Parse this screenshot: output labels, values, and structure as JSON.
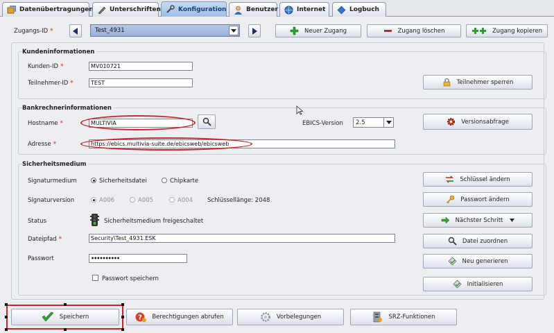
{
  "tabs": [
    {
      "label": "Datenübertragungen",
      "icon": "data-transfer-icon"
    },
    {
      "label": "Unterschriften",
      "icon": "pen-icon"
    },
    {
      "label": "Konfiguration",
      "icon": "wrench-icon",
      "active": true
    },
    {
      "label": "Benutzer",
      "icon": "user-icon"
    },
    {
      "label": "Internet",
      "icon": "globe-icon"
    },
    {
      "label": "Logbuch",
      "icon": "book-icon"
    }
  ],
  "toolbar": {
    "zugangs_label": "Zugangs-ID",
    "zugangs_value": "Test_4931",
    "new_label": "Neuer Zugang",
    "delete_label": "Zugang löschen",
    "copy_label": "Zugang kopieren"
  },
  "kunden": {
    "title": "Kundeninformationen",
    "kunden_id_label": "Kunden-ID",
    "kunden_id_value": "MV010721",
    "teilnehmer_label": "Teilnehmer-ID",
    "teilnehmer_value": "TEST",
    "sperren_label": "Teilnehmer sperren"
  },
  "bank": {
    "title": "Bankrechnerinformationen",
    "hostname_label": "Hostname",
    "hostname_value": "MULTIVIA",
    "ebics_label": "EBICS-Version",
    "ebics_value": "2.5",
    "versions_label": "Versionsabfrage",
    "adresse_label": "Adresse",
    "adresse_value": "https://ebics.multivia-suite.de/ebicsweb/ebicsweb"
  },
  "sicherheit": {
    "title": "Sicherheitsmedium",
    "signaturmedium_label": "Signaturmedium",
    "opt_datei": "Sicherheitsdatei",
    "opt_karte": "Chipkarte",
    "signaturversion_label": "Signaturversion",
    "v1": "A006",
    "v2": "A005",
    "v3": "A004",
    "schluessellaenge": "Schlüssellänge: 2048",
    "status_label": "Status",
    "status_value": "Sicherheitsmedium freigeschaltet",
    "dateipfad_label": "Dateipfad",
    "dateipfad_value": "Security\\Test_4931.ESK",
    "passwort_label": "Passwort",
    "passwort_value": "••••••••••",
    "passwort_speichern": "Passwort speichern",
    "btn_schluessel": "Schlüssel ändern",
    "btn_passwort": "Passwort ändern",
    "btn_naechster": "Nächster Schritt",
    "btn_datei": "Datei zuordnen",
    "btn_neu": "Neu generieren",
    "btn_init": "Initialisieren"
  },
  "bottom": {
    "speichern": "Speichern",
    "berechtigungen": "Berechtigungen abrufen",
    "vorbelegungen": "Vorbelegungen",
    "srz": "SRZ-Funktionen"
  },
  "colors": {
    "accent": "#9fbde6",
    "required": "#e3562a",
    "highlight": "#c9242b"
  }
}
